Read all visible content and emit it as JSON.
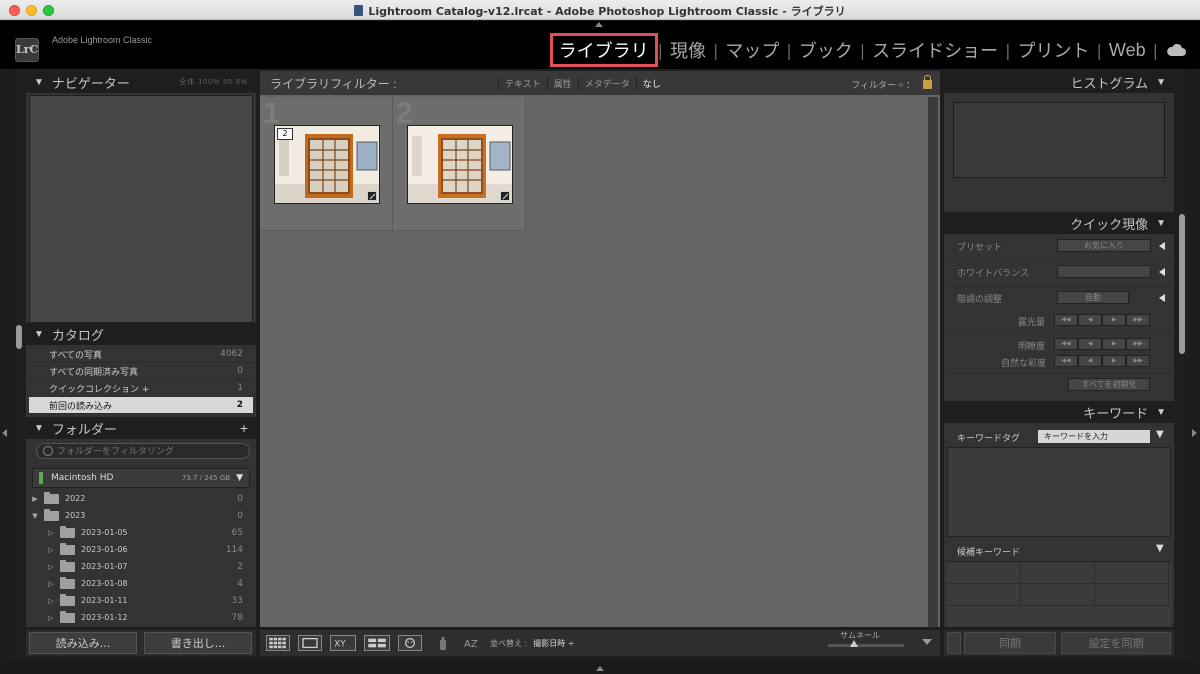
{
  "window": {
    "title": "Lightroom Catalog-v12.lrcat - Adobe Photoshop Lightroom Classic - ライブラリ"
  },
  "identity": {
    "logo": "LrC",
    "app_name": "Adobe Lightroom Classic"
  },
  "modules": [
    "ライブラリ",
    "現像",
    "マップ",
    "ブック",
    "スライドショー",
    "プリント",
    "Web"
  ],
  "active_module": "ライブラリ",
  "icons": {
    "cloud": "cloud-icon",
    "lock": "lock-icon",
    "search": "search-icon"
  },
  "colors": {
    "accent_highlight": "#e44e5c",
    "bg": "#333333",
    "grid_bg": "#656565",
    "lock": "#c9a23c"
  },
  "navigator": {
    "title": "ナビゲーター",
    "zoom": "全体  100%  55.5%"
  },
  "catalog": {
    "title": "カタログ",
    "items": [
      {
        "label": "すべての写真",
        "count": "4062"
      },
      {
        "label": "すべての同期済み写真",
        "count": "0"
      },
      {
        "label": "クイックコレクション +",
        "count": "1"
      },
      {
        "label": "前回の読み込み",
        "count": "2"
      }
    ]
  },
  "folders": {
    "title": "フォルダー",
    "add": "+",
    "search_placeholder": "フォルダーをフィルタリング",
    "volume": {
      "name": "Macintosh HD",
      "size": "73.7 / 245 GB"
    },
    "items": [
      {
        "name": "2022",
        "count": "0",
        "level": 0,
        "open": false
      },
      {
        "name": "2023",
        "count": "0",
        "level": 0,
        "open": true
      },
      {
        "name": "2023-01-05",
        "count": "65",
        "level": 1
      },
      {
        "name": "2023-01-06",
        "count": "114",
        "level": 1
      },
      {
        "name": "2023-01-07",
        "count": "2",
        "level": 1
      },
      {
        "name": "2023-01-08",
        "count": "4",
        "level": 1
      },
      {
        "name": "2023-01-11",
        "count": "33",
        "level": 1
      },
      {
        "name": "2023-01-12",
        "count": "78",
        "level": 1
      }
    ]
  },
  "left_buttons": {
    "import": "読み込み...",
    "export": "書き出し..."
  },
  "filter_bar": {
    "title": "ライブラリフィルター :",
    "options": [
      "テキスト",
      "属性",
      "メタデータ",
      "なし"
    ],
    "active": "なし",
    "right": "フィルター ÷ ："
  },
  "grid": {
    "cells": [
      {
        "index": "1",
        "badge": "2"
      },
      {
        "index": "2",
        "badge": ""
      }
    ]
  },
  "toolbar": {
    "sort_label": "並べ替え :",
    "sort_value": "撮影日時 ÷",
    "thumb_label": "サムネール"
  },
  "histogram": {
    "title": "ヒストグラム"
  },
  "quick_develop": {
    "title": "クイック現像",
    "preset_label": "プリセット",
    "preset_value": "お気に入り",
    "wb_label": "ホワイトバランス",
    "wb_value": "",
    "tone_label": "階調の調整",
    "tone_value": "自動",
    "exposure": "露光量",
    "clarity": "明瞭度",
    "vibrance": "自然な彩度",
    "reset": "すべてを初期化"
  },
  "keywords": {
    "title": "キーワード",
    "tag_label": "キーワードタグ",
    "input_placeholder": "キーワードを入力",
    "suggestions": "候補キーワード"
  },
  "right_buttons": {
    "sync_meta": "同期",
    "sync_settings": "設定を同期"
  }
}
